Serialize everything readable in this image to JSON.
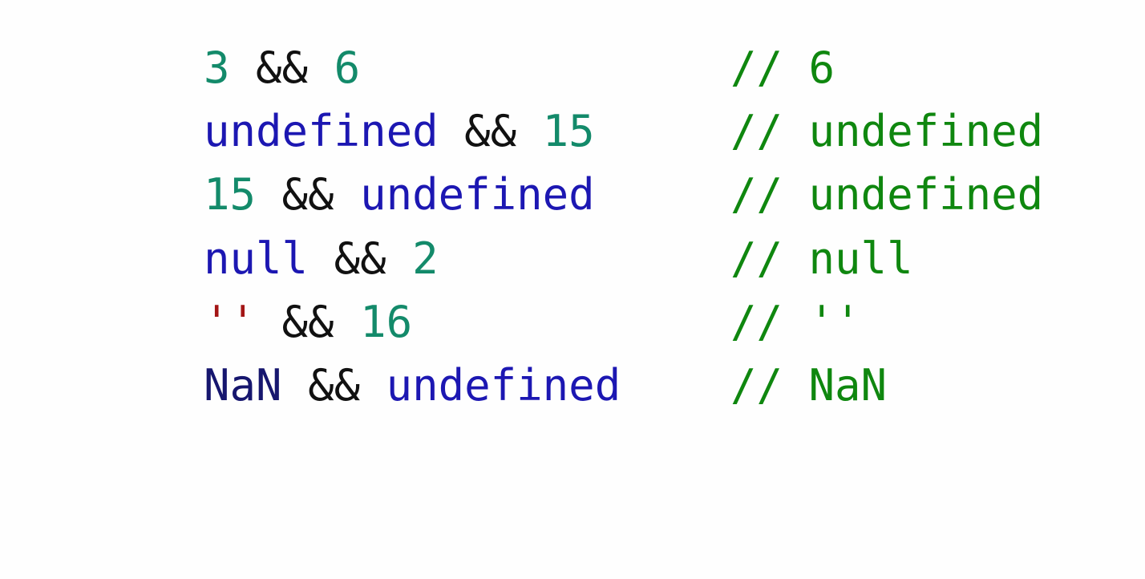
{
  "colors": {
    "number": "#138a6a",
    "keyword": "#1c17b2",
    "operator": "#111111",
    "string": "#a31515",
    "global": "#16166e",
    "comment": "#0f870f",
    "background": "#fefefe"
  },
  "lines": [
    {
      "tokens": [
        {
          "text": "3",
          "kind": "number"
        },
        {
          "text": " ",
          "kind": "space"
        },
        {
          "text": "&&",
          "kind": "operator"
        },
        {
          "text": " ",
          "kind": "space"
        },
        {
          "text": "6",
          "kind": "number"
        }
      ],
      "comment": "// 6"
    },
    {
      "tokens": [
        {
          "text": "undefined",
          "kind": "keyword"
        },
        {
          "text": " ",
          "kind": "space"
        },
        {
          "text": "&&",
          "kind": "operator"
        },
        {
          "text": " ",
          "kind": "space"
        },
        {
          "text": "15",
          "kind": "number"
        }
      ],
      "comment": "// undefined"
    },
    {
      "tokens": [
        {
          "text": "15",
          "kind": "number"
        },
        {
          "text": " ",
          "kind": "space"
        },
        {
          "text": "&&",
          "kind": "operator"
        },
        {
          "text": " ",
          "kind": "space"
        },
        {
          "text": "undefined",
          "kind": "keyword"
        }
      ],
      "comment": "// undefined"
    },
    {
      "tokens": [
        {
          "text": "null",
          "kind": "keyword"
        },
        {
          "text": " ",
          "kind": "space"
        },
        {
          "text": "&&",
          "kind": "operator"
        },
        {
          "text": " ",
          "kind": "space"
        },
        {
          "text": "2",
          "kind": "number"
        }
      ],
      "comment": "// null"
    },
    {
      "tokens": [
        {
          "text": "''",
          "kind": "string"
        },
        {
          "text": " ",
          "kind": "space"
        },
        {
          "text": "&&",
          "kind": "operator"
        },
        {
          "text": " ",
          "kind": "space"
        },
        {
          "text": "16",
          "kind": "number"
        }
      ],
      "comment": "// ''"
    },
    {
      "tokens": [
        {
          "text": "NaN",
          "kind": "global"
        },
        {
          "text": " ",
          "kind": "space"
        },
        {
          "text": "&&",
          "kind": "operator"
        },
        {
          "text": " ",
          "kind": "space"
        },
        {
          "text": "undefined",
          "kind": "keyword"
        }
      ],
      "comment": "// NaN"
    }
  ]
}
